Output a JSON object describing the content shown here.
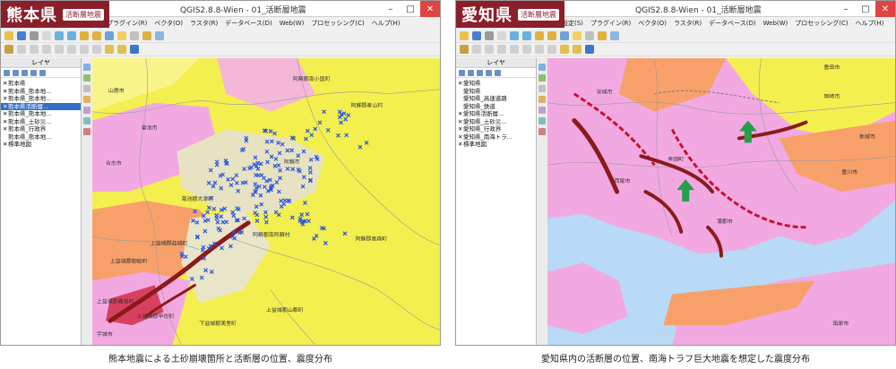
{
  "colors": {
    "badge": "#8a1f2b",
    "layer_select": "#2f6fc6",
    "fault": "#8b1a1a",
    "marker": "#2a55e0",
    "arrow": "#22a04a"
  },
  "left": {
    "pref": "熊本県",
    "tag": "活断層地震",
    "window_title": "QGIS2.8.8-Wien - 01_活断層地震",
    "menu": [
      "プラグイン(R)",
      "ベクタ(O)",
      "ラスタ(R)",
      "データベース(D)",
      "Web(W)",
      "プロセッシング(C)",
      "ヘルプ(H)"
    ],
    "layer_panel_title": "レイヤ",
    "layers": [
      {
        "check": "✕",
        "label": "熊本県"
      },
      {
        "check": "✕",
        "label": "熊本県_熊本地..."
      },
      {
        "check": "✕",
        "label": "熊本県_熊本地..."
      },
      {
        "check": "✕",
        "label": "熊本県活断層..."
      },
      {
        "check": "✕",
        "label": "熊本県_熊本地..."
      },
      {
        "check": "✕",
        "label": "熊本県_土砂災..."
      },
      {
        "check": "✕",
        "label": "熊本県_行政界"
      },
      {
        "check": "",
        "label": "熊本県_熊本地..."
      },
      {
        "check": "✕",
        "label": "標準地図"
      }
    ],
    "map_labels": [
      "阿蘇郡南小国町",
      "阿蘇郡産山村",
      "山鹿市",
      "菊池市",
      "合志市",
      "菊池郡大津町",
      "阿蘇市",
      "阿蘇郡高森町",
      "上益城郡山都町",
      "上益城郡御船町",
      "上益城郡益城町",
      "阿蘇郡南阿蘇村",
      "上益城郡嘉島町",
      "宇城市",
      "下益城郡美里町",
      "上益城郡甲佐町"
    ],
    "caption": "熊本地震による土砂崩壊箇所と活断層の位置、震度分布"
  },
  "right": {
    "pref": "愛知県",
    "tag": "活断層地震",
    "window_title": "QGIS2.8.8-Wien - 01_活断層地震",
    "menu": [
      "設定(S)",
      "プラグイン(R)",
      "ベクタ(O)",
      "ラスタ(R)",
      "データベース(D)",
      "Web(W)",
      "プロセッシング(C)",
      "ヘルプ(H)"
    ],
    "layer_panel_title": "レイヤ",
    "layers": [
      {
        "check": "✕",
        "label": "愛知県"
      },
      {
        "check": "",
        "label": "愛知県"
      },
      {
        "check": "",
        "label": "愛知県_高速道路"
      },
      {
        "check": "",
        "label": "愛知県_鉄道"
      },
      {
        "check": "✕",
        "label": "愛知県活断層..."
      },
      {
        "check": "✕",
        "label": "愛知県_土砂災..."
      },
      {
        "check": "✕",
        "label": "愛知県_行政界"
      },
      {
        "check": "✕",
        "label": "愛知県_南海トラ..."
      },
      {
        "check": "✕",
        "label": "標準地図"
      }
    ],
    "map_labels": [
      "岡崎市",
      "豊田市",
      "安城市",
      "西尾市",
      "幸田町",
      "蒲郡市",
      "豊川市",
      "新城市",
      "田原市"
    ],
    "caption": "愛知県内の活断層の位置、南海トラフ巨大地震を想定した震度分布"
  }
}
